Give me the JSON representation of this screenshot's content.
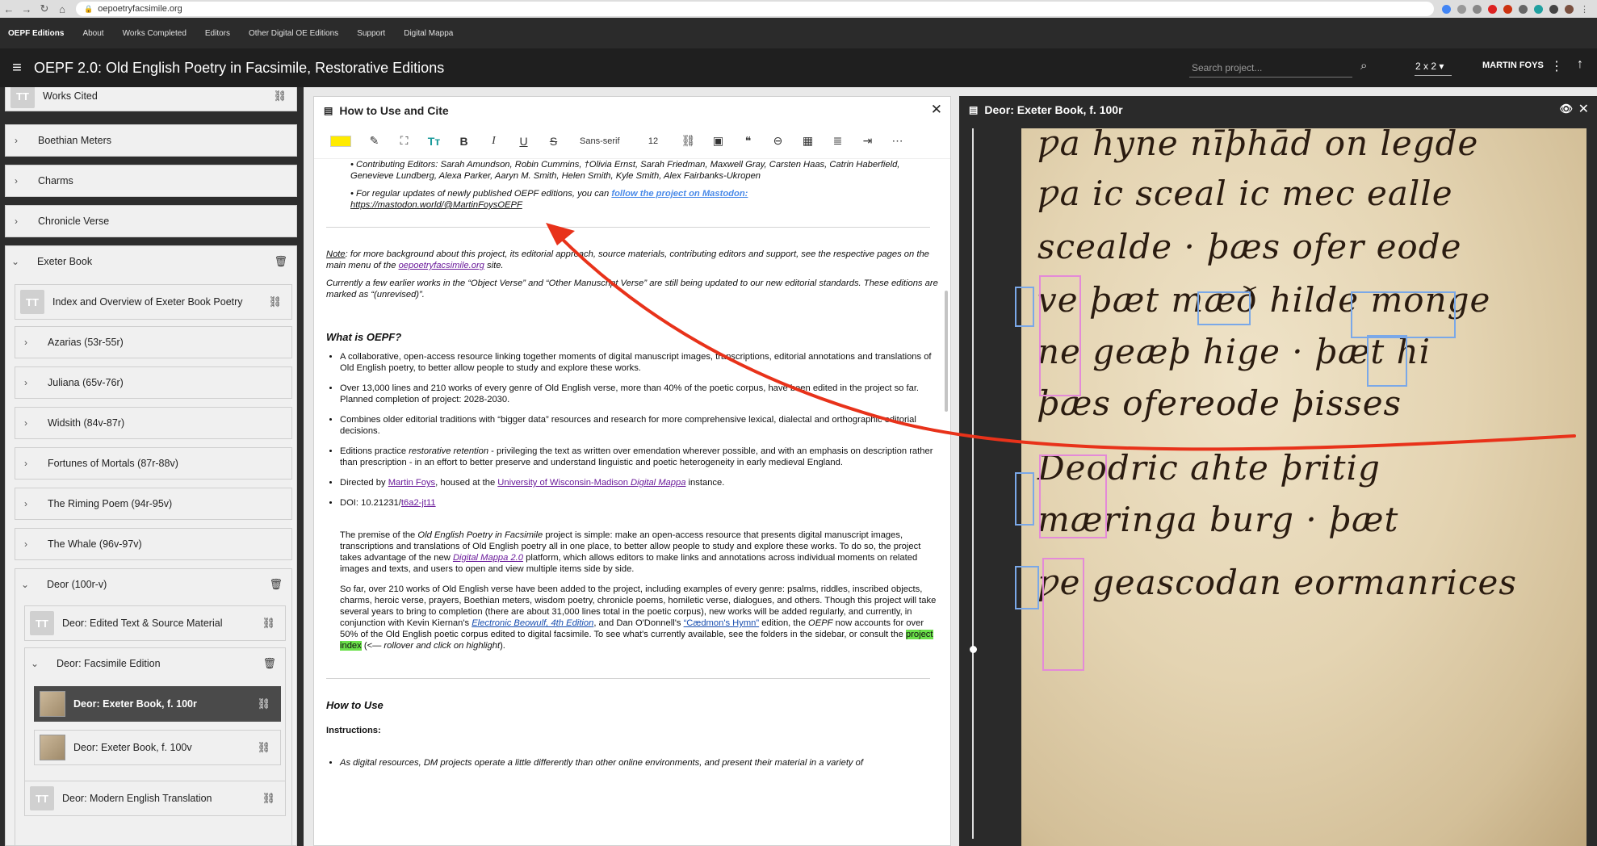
{
  "browser": {
    "url": "oepoetryfacsimile.org"
  },
  "topnav": {
    "items": [
      "OEPF Editions",
      "About",
      "Works Completed",
      "Editors",
      "Other Digital OE Editions",
      "Support",
      "Digital Mappa"
    ]
  },
  "appbar": {
    "title": "OEPF 2.0: Old English Poetry in Facsimile, Restorative Editions",
    "search_placeholder": "Search project...",
    "layout": "2 x 2",
    "user": "MARTIN FOYS"
  },
  "sidebar": {
    "items": [
      {
        "label": "Works Cited",
        "kind": "text"
      },
      {
        "label": "Boethian Meters",
        "kind": "folder"
      },
      {
        "label": "Charms",
        "kind": "folder"
      },
      {
        "label": "Chronicle Verse",
        "kind": "folder"
      },
      {
        "label": "Exeter Book",
        "kind": "folder-open"
      },
      {
        "label": "Index and Overview of Exeter Book Poetry",
        "kind": "text"
      },
      {
        "label": "Azarias (53r-55r)",
        "kind": "folder"
      },
      {
        "label": "Juliana (65v-76r)",
        "kind": "folder"
      },
      {
        "label": "Widsith (84v-87r)",
        "kind": "folder"
      },
      {
        "label": "Fortunes of Mortals (87r-88v)",
        "kind": "folder"
      },
      {
        "label": "The Riming Poem (94r-95v)",
        "kind": "folder"
      },
      {
        "label": "The Whale (96v-97v)",
        "kind": "folder"
      },
      {
        "label": "Deor (100r-v)",
        "kind": "folder-open"
      },
      {
        "label": "Deor: Edited Text & Source Material",
        "kind": "text"
      },
      {
        "label": "Deor: Facsimile Edition",
        "kind": "folder-open"
      },
      {
        "label": "Deor: Exeter Book, f. 100r",
        "kind": "image"
      },
      {
        "label": "Deor: Exeter Book, f. 100v",
        "kind": "image"
      },
      {
        "label": "Deor: Modern English Translation",
        "kind": "text"
      }
    ],
    "tt_glyph": "TT"
  },
  "mid_panel": {
    "title": "How to Use and Cite",
    "toolbar": {
      "highlight_color": "#ffeb00",
      "font": "Sans-serif",
      "size": "12"
    },
    "p1_a": "• Contributing Editors: Sarah Amundson, Robin Cummins, †Olivia Ernst, Sarah Friedman, Maxwell Gray, Carsten Haas, Catrin Haberfield, Genevieve Lundberg, Alexa Parker, Aaryn M. Smith, Helen Smith, Kyle Smith, Alex Fairbanks-Ukropen",
    "p2_a": "• For regular updates of newly published OEPF editions, you can ",
    "p2_link": "follow the project on Mastodon:",
    "p2_b": "https://mastodon.world/@MartinFoysOEPF",
    "note_label": "Note",
    "note_a": ": for more background about this project, its editorial approach, source materials, contributing editors and support, see the respective pages on the main menu of the ",
    "note_link": "oepoetryfacsimile.org",
    "note_b": " site.",
    "current_note": "Currently a few earlier works in the “Object Verse” and “Other Manuscript Verse” are still being updated to our new editorial standards. These editions are marked as “(unrevised)”.",
    "what_heading": "What is OEPF?",
    "b1": "A collaborative, open-access resource linking together moments of digital manuscript images, transcriptions, editorial annotations and translations of Old English poetry, to better allow people to study and explore these works.",
    "b2": "Over 13,000 lines and 210 works of every genre of Old English verse, more than 40% of the poetic corpus, have been edited in the project so far. Planned completion of project: 2028-2030.",
    "b3": "Combines older editorial traditions with “bigger data” resources and research for more comprehensive lexical, dialectal and orthographic editorial decisions.",
    "b4_a": "Editions practice ",
    "b4_i": "restorative retention",
    "b4_b": " - privileging the text as written over emendation wherever possible, and with an emphasis on description rather than prescription - in an effort to better preserve and understand linguistic and poetic heterogeneity in early medieval England.",
    "b5_a": "Directed by ",
    "b5_link1": "Martin Foys",
    "b5_b": ", housed at the ",
    "b5_link2": "University of Wisconsin-Madison ",
    "b5_link2i": "Digital Mappa",
    "b5_c": " instance.",
    "b6_a": "DOI: 10.21231/",
    "b6_link": "t6a2-jt11",
    "premise_a": "The premise of the ",
    "premise_i": "Old English Poetry in Facsimile",
    "premise_b": " project is simple: make an open-access resource that presents digital manuscript images, transcriptions and translations of Old English poetry all in one place, to better allow people to study and explore these works. To do so, the project takes advantage of the new ",
    "premise_link": "Digital Mappa 2.0",
    "premise_c": " platform, which allows editors to make links and annotations across individual moments on related images and texts, and users to open and view multiple items side by side.",
    "sofar_a": "So far, over 210 works of Old English verse have been added to the project, including examples of every genre: psalms, riddles, inscribed objects, charms, heroic verse, prayers, Boethian meters, wisdom poetry, chronicle poems, homiletic verse, dialogues, and others. Though this project will take several years to bring to completion (there are about 31,000 lines total in the poetic corpus), new works will be added regularly, and currently, in conjunction with Kevin Kiernan's ",
    "sofar_link1": "Electronic Beowulf, 4th Edition",
    "sofar_b": ", and Dan O'Donnell's ",
    "sofar_link2": "“Cædmon's Hymn”",
    "sofar_c": " edition, the ",
    "sofar_i": "OEPF",
    "sofar_d": " now accounts for over 50% of the Old English poetic corpus edited to digital facsimile. To see what's currently available, see the folders in the sidebar, or consult the ",
    "sofar_hl": "project index",
    "sofar_e": " (<— ",
    "sofar_i2": "rollover and click on highlight",
    "sofar_f": ").",
    "howto_heading": "How to Use",
    "instructions": "Instructions:",
    "last_bullet": "As digital resources, DM projects operate a little differently than other online environments, and present their material in a variety of"
  },
  "right_panel": {
    "title": "Deor: Exeter Book, f. 100r",
    "ms_lines": [
      "ƿa hyne nīþhād on legde",
      "ƿa ic sceal ic mec ealle",
      "scealde · þæs ofer eode",
      "ve þæt mæð hilde monge",
      "ne geæþ hige · þæt hi",
      "þæs ofereode þisses",
      "Deodric ahte þritig",
      "mæringa burg · þæt",
      "ƿe geascodan eormanrices"
    ]
  }
}
